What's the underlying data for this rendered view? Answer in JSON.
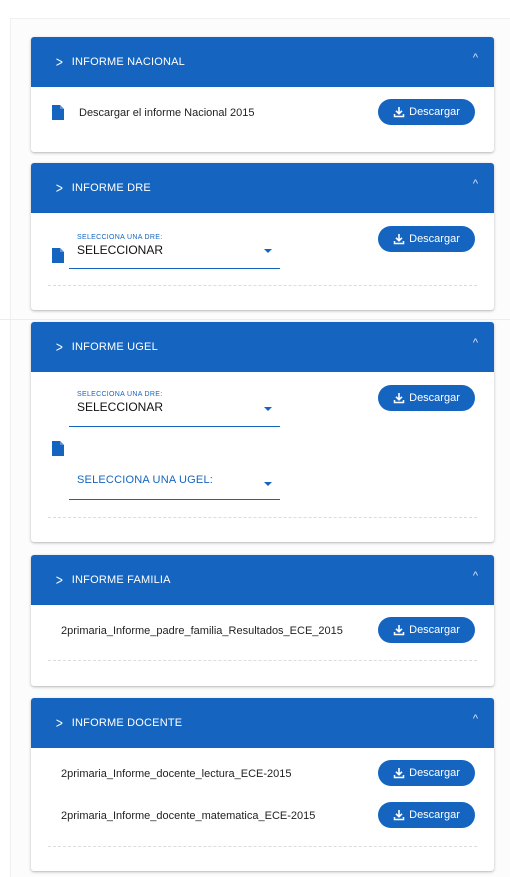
{
  "cards": [
    {
      "title": "INFORME NACIONAL",
      "row": "Descargar el informe Nacional 2015",
      "button": "Descargar"
    },
    {
      "title": "INFORME DRE",
      "select_label": "SELECCIONA UNA DRE:",
      "select_value": "SELECCIONAR",
      "button": "Descargar"
    },
    {
      "title": "INFORME UGEL",
      "select_label": "SELECCIONA UNA DRE:",
      "select_value": "SELECCIONAR",
      "ugel_label": "SELECCIONA UNA UGEL:",
      "button": "Descargar"
    },
    {
      "title": "INFORME FAMILIA",
      "rows": [
        "2primaria_Informe_padre_familia_Resultados_ECE_2015"
      ],
      "button": "Descargar"
    },
    {
      "title": "INFORME DOCENTE",
      "rows": [
        "2primaria_Informe_docente_lectura_ECE-2015",
        "2primaria_Informe_docente_matematica_ECE-2015"
      ],
      "button": "Descargar"
    }
  ],
  "icons": {
    "chevron": "chevron-right-icon",
    "caret": "caret-up-icon",
    "document": "document-icon",
    "download": "download-icon",
    "dropdown": "dropdown-arrow-icon"
  },
  "colors": {
    "primary": "#1565c0",
    "header_text": "#ffffff"
  }
}
